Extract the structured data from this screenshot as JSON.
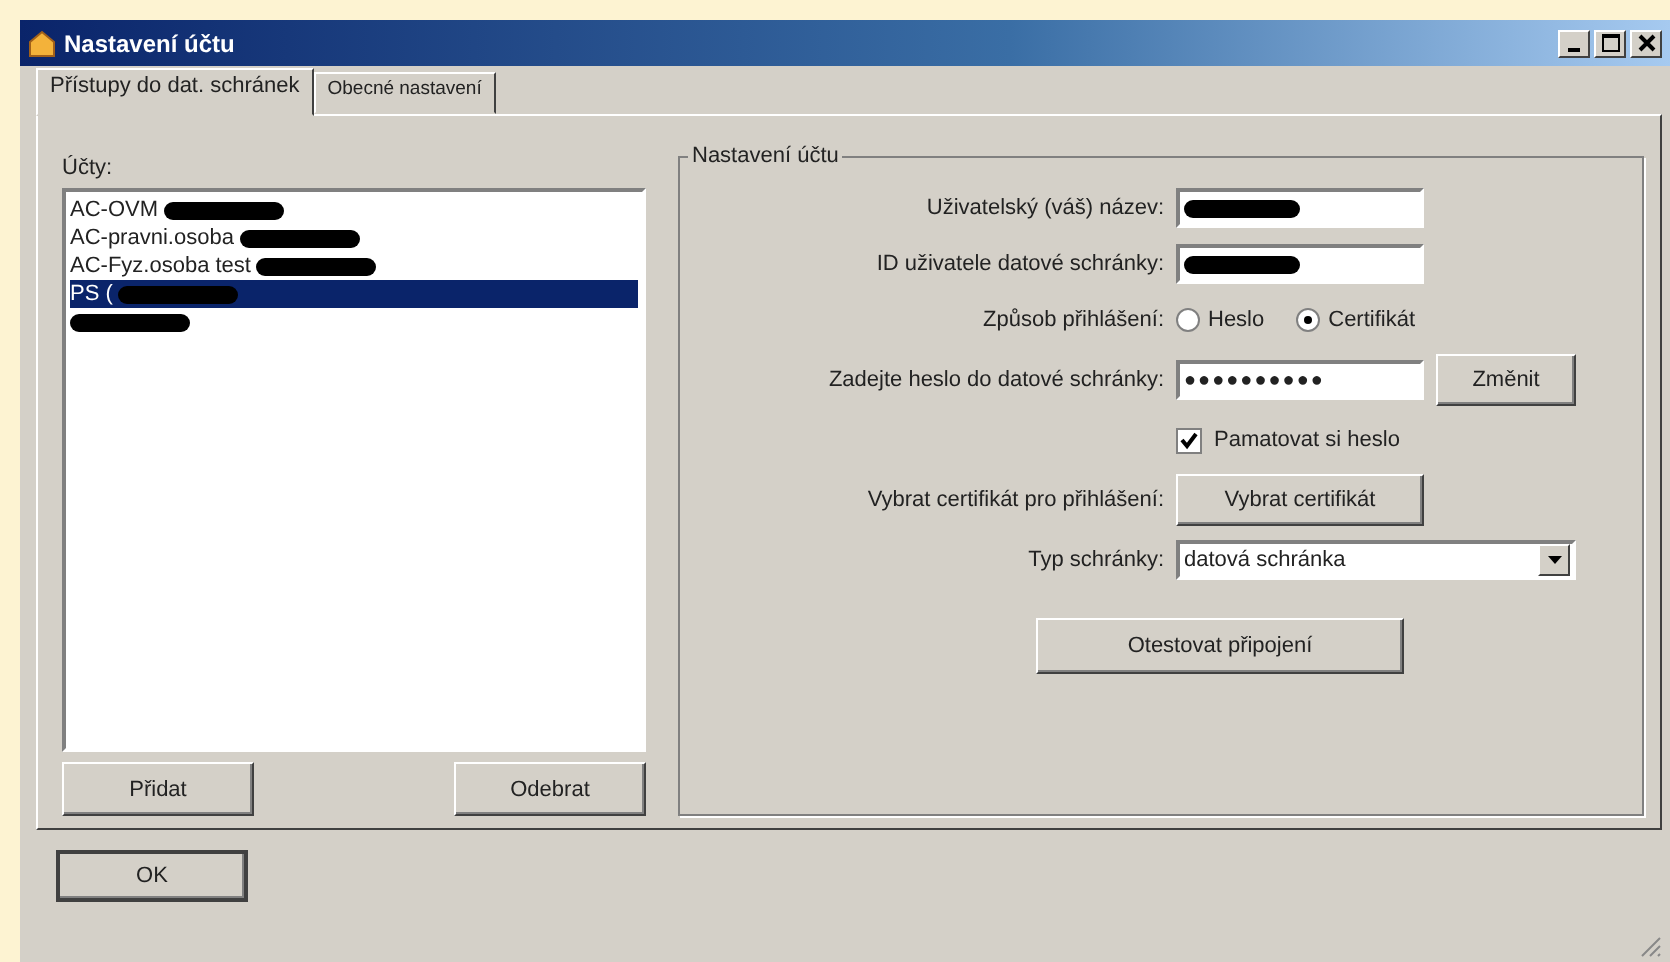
{
  "window": {
    "title": "Nastavení účtu"
  },
  "tabs": [
    {
      "label": "Přístupy do dat. schránek",
      "selected": true
    },
    {
      "label": "Obecné nastavení",
      "selected": false
    }
  ],
  "accounts": {
    "label": "Účty:",
    "items": [
      {
        "text": "AC-OVM",
        "redacted": true,
        "selected": false
      },
      {
        "text": "AC-pravni.osoba",
        "redacted": true,
        "selected": false
      },
      {
        "text": "AC-Fyz.osoba test",
        "redacted": true,
        "selected": false
      },
      {
        "text": "PS (",
        "redacted": true,
        "selected": true
      },
      {
        "redacted": true,
        "selected": false
      }
    ],
    "buttons": [
      "Přidat",
      "Odebrat"
    ]
  },
  "settings": {
    "legend": "Nastavení účtu",
    "username": {
      "label": "Uživatelský (váš) název:",
      "redacted": true
    },
    "user_id": {
      "label": "ID uživatele datové schránky:",
      "redacted": true
    },
    "login_method": {
      "label": "Způsob přihlášení:",
      "options": [
        {
          "label": "Heslo",
          "selected": false
        },
        {
          "label": "Certifikát",
          "selected": true
        }
      ]
    },
    "password": {
      "label": "Zadejte heslo do datové schránky:",
      "value": "●●●●●●●●●●",
      "button": "Změnit"
    },
    "remember": {
      "label": "Pamatovat si heslo",
      "checked": true
    },
    "certificate": {
      "label": "Vybrat certifikát pro přihlášení:",
      "button": "Vybrat certifikát"
    },
    "box_type": {
      "label": "Typ schránky:",
      "value": "datová schránka"
    },
    "test_button": "Otestovat připojení"
  },
  "buttons": [
    "OK"
  ]
}
